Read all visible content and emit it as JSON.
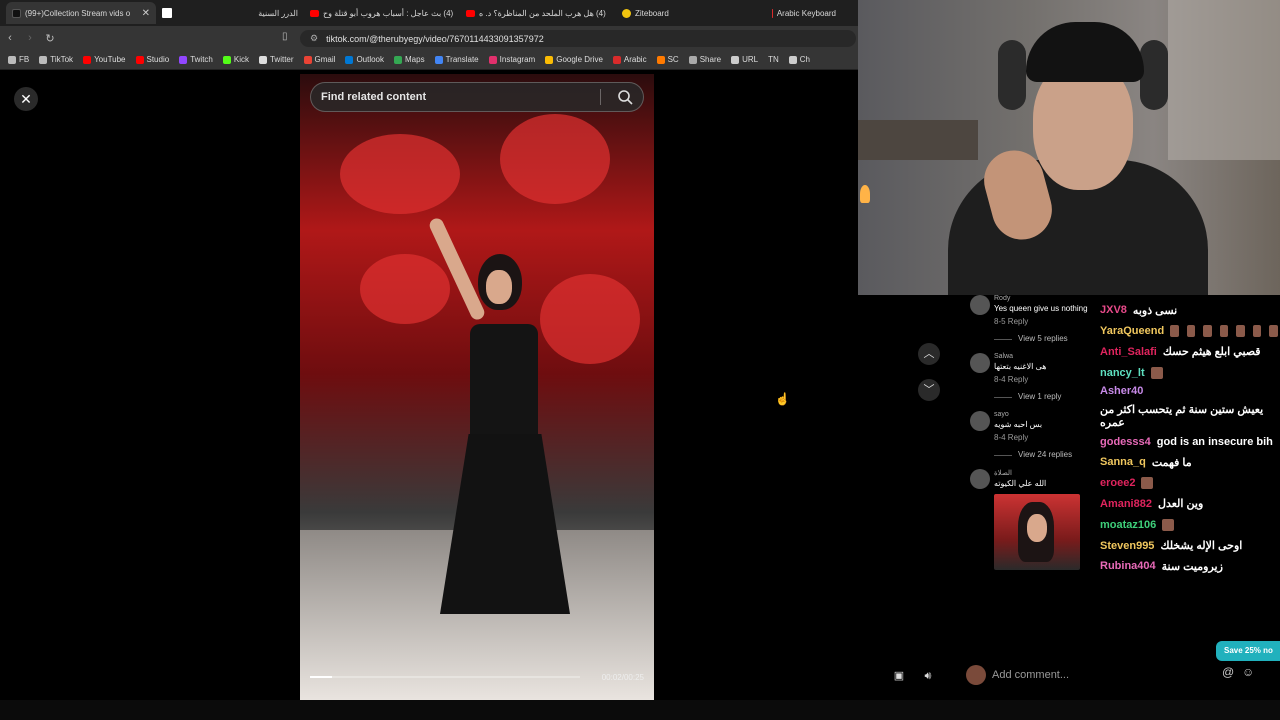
{
  "browser": {
    "tabs": [
      {
        "title": "(99+)Collection Stream vids o",
        "icon": "tiktok-icon",
        "active": true
      },
      {
        "title": "",
        "icon": "blank-page-icon",
        "active": false
      },
      {
        "title": "الدرر السنية",
        "icon": "",
        "active": false
      },
      {
        "title": "(4) بث عاجل : أسباب هروب أبو قتلة وح",
        "icon": "youtube-icon",
        "active": false
      },
      {
        "title": "(4) هل هرب الملحد من المناظرة؟ د. ه",
        "icon": "youtube-icon",
        "active": false
      },
      {
        "title": "Ziteboard",
        "icon": "ziteboard-icon",
        "active": false
      },
      {
        "title": "Arabic Keyboard",
        "icon": "arabic-keyboard-icon",
        "active": false
      }
    ],
    "url": "tiktok.com/@therubyegy/video/7670114433091357972",
    "bookmarks": [
      {
        "label": "FB",
        "icon": "folder-icon"
      },
      {
        "label": "TikTok",
        "icon": "folder-icon"
      },
      {
        "label": "YouTube",
        "icon": "youtube-icon"
      },
      {
        "label": "Studio",
        "icon": "youtube-studio-icon"
      },
      {
        "label": "Twitch",
        "icon": "twitch-icon"
      },
      {
        "label": "Kick",
        "icon": "kick-icon"
      },
      {
        "label": "Twitter",
        "icon": "x-icon"
      },
      {
        "label": "Gmail",
        "icon": "gmail-icon"
      },
      {
        "label": "Outlook",
        "icon": "outlook-icon"
      },
      {
        "label": "Maps",
        "icon": "maps-icon"
      },
      {
        "label": "Translate",
        "icon": "translate-icon"
      },
      {
        "label": "Instagram",
        "icon": "instagram-icon"
      },
      {
        "label": "Google Drive",
        "icon": "drive-icon"
      },
      {
        "label": "Arabic",
        "icon": "arabic-icon"
      },
      {
        "label": "SC",
        "icon": "sc-icon"
      },
      {
        "label": "Share",
        "icon": "cloud-icon"
      },
      {
        "label": "URL",
        "icon": "url-icon"
      },
      {
        "label": "TN",
        "icon": ""
      },
      {
        "label": "Ch",
        "icon": "chat-icon"
      }
    ]
  },
  "video": {
    "search_placeholder": "Find related content",
    "time": "00:02/00:25",
    "progress": 0.08
  },
  "comments": [
    {
      "user": "Rody",
      "text": "Yes queen give us nothing",
      "meta": "8-5   Reply",
      "replies": "View 5 replies"
    },
    {
      "user": "Salwa",
      "text": "هى الاغنيه بتعتها",
      "meta": "8-4   Reply",
      "replies": "View 1 reply"
    },
    {
      "user": "sayo",
      "text": "بس احبه شويه",
      "meta": "8-4   Reply",
      "replies": "View 24 replies"
    },
    {
      "user": "الصلاة",
      "text": "الله علي الكيوته",
      "meta": "",
      "replies": ""
    }
  ],
  "comment_input": {
    "placeholder": "Add comment..."
  },
  "promo": "Save 25% no",
  "chat": [
    {
      "name": "JXV8",
      "msg": "نسى ذوبه",
      "color": "#e84a8a"
    },
    {
      "name": "YaraQueend",
      "msg": "",
      "color": "#f0c75e"
    },
    {
      "name": "Anti_Salafi",
      "msg": "قصبي ابلع هيثم حسك",
      "color": "#e0245e"
    },
    {
      "name": "nancy_lt",
      "msg": "",
      "color": "#5ee0c0"
    },
    {
      "name": "Asher40",
      "msg": "يعيش ستين سنة ثم يتحسب اكثر من عمره",
      "color": "#c78ae8"
    },
    {
      "name": "godesss4",
      "msg": "god is an insecure bih",
      "color": "#e86ab8"
    },
    {
      "name": "Sanna_q",
      "msg": "ما فهمت",
      "color": "#f0c75e"
    },
    {
      "name": "eroee2",
      "msg": "",
      "color": "#e0245e"
    },
    {
      "name": "Amani882",
      "msg": "وين العدل",
      "color": "#e0245e"
    },
    {
      "name": "moataz106",
      "msg": "",
      "color": "#3ecf7a"
    },
    {
      "name": "Steven995",
      "msg": "اوحى الإله يشخلك",
      "color": "#f0c75e"
    },
    {
      "name": "Rubina404",
      "msg": "زيروميت سنة",
      "color": "#e86ab8"
    }
  ]
}
